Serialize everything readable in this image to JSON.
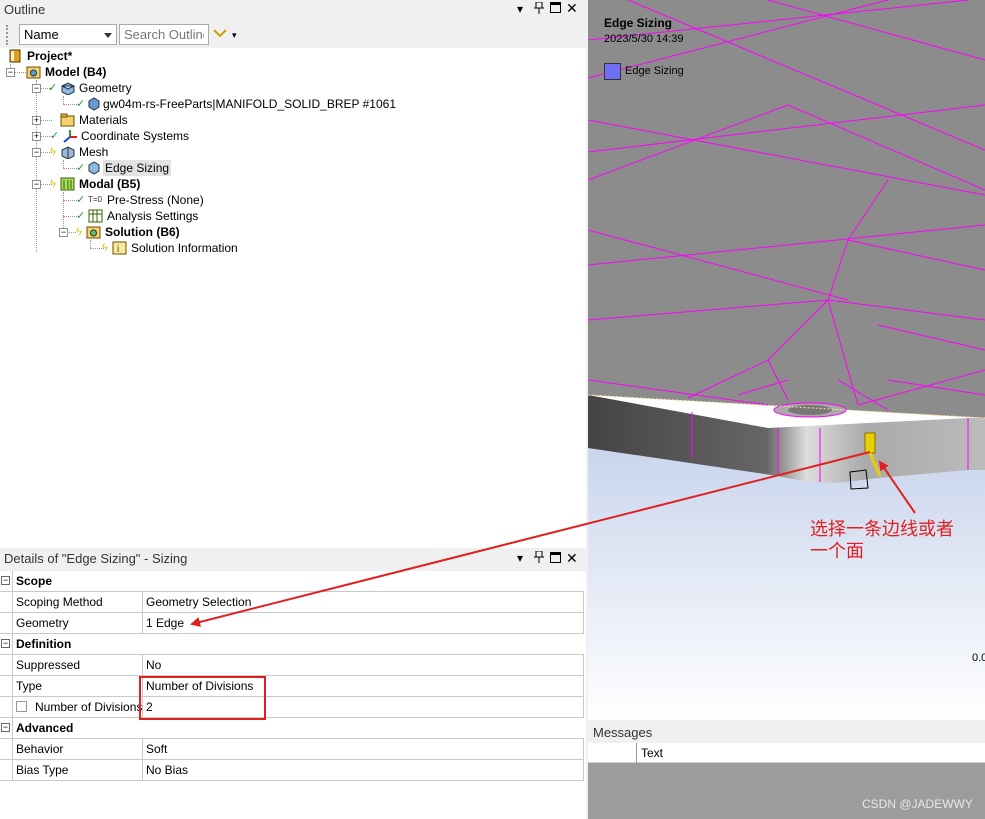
{
  "outline": {
    "title": "Outline",
    "pin_icon": "pin-icon",
    "name_select": "Name",
    "search_placeholder": "Search Outline",
    "tree": {
      "project": "Project*",
      "model": "Model (B4)",
      "geometry": "Geometry",
      "part": "gw04m-rs-FreeParts|MANIFOLD_SOLID_BREP #1061",
      "materials": "Materials",
      "coordinate_systems": "Coordinate Systems",
      "mesh": "Mesh",
      "edge_sizing": "Edge Sizing",
      "modal": "Modal (B5)",
      "pre_stress": "Pre-Stress (None)",
      "analysis_settings": "Analysis Settings",
      "solution": "Solution (B6)",
      "solution_info": "Solution Information",
      "pre_stress_icon_text": "T=0"
    }
  },
  "details": {
    "title": "Details of \"Edge Sizing\" - Sizing",
    "groups": {
      "scope": "Scope",
      "definition": "Definition",
      "advanced": "Advanced"
    },
    "rows": {
      "scoping_method": {
        "key": "Scoping Method",
        "value": "Geometry Selection"
      },
      "geometry": {
        "key": "Geometry",
        "value": "1 Edge"
      },
      "suppressed": {
        "key": "Suppressed",
        "value": "No"
      },
      "type": {
        "key": "Type",
        "value": "Number of Divisions"
      },
      "num_divisions": {
        "key": "Number of Divisions",
        "value": "2"
      },
      "behavior": {
        "key": "Behavior",
        "value": "Soft"
      },
      "bias_type": {
        "key": "Bias Type",
        "value": "No Bias"
      }
    }
  },
  "viewport": {
    "title": "Edge Sizing",
    "date": "2023/5/30 14:39",
    "legend_label": "Edge Sizing",
    "legend_color": "#6e6ef7",
    "scale_text": "0.0",
    "mesh_color": "#ff00ff",
    "annotation_line1": "选择一条边线或者",
    "annotation_line2": "一个面",
    "annotation_color": "#e02020"
  },
  "messages": {
    "title": "Messages",
    "col_text": "Text"
  },
  "watermark": "CSDN @JADEWWY"
}
